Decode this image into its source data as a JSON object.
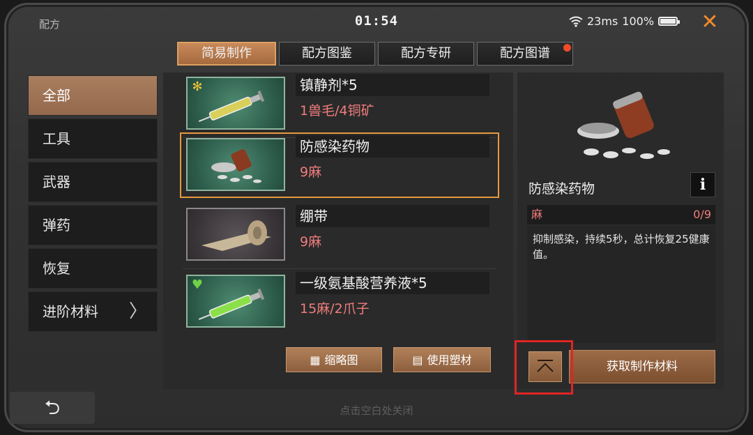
{
  "header": {
    "app_title": "配方",
    "clock": "01:54",
    "ping": "23ms",
    "battery": "100%",
    "close_icon": "close-icon"
  },
  "tabs": [
    {
      "label": "简易制作",
      "active": true
    },
    {
      "label": "配方图鉴",
      "active": false
    },
    {
      "label": "配方专研",
      "active": false
    },
    {
      "label": "配方图谱",
      "active": false,
      "has_badge": true
    }
  ],
  "sidebar": {
    "items": [
      {
        "label": "全部",
        "active": true
      },
      {
        "label": "工具"
      },
      {
        "label": "武器"
      },
      {
        "label": "弹药"
      },
      {
        "label": "恢复"
      },
      {
        "label": "进阶材料",
        "has_arrow": true
      }
    ]
  },
  "recipes": [
    {
      "name": "镇静剂*5",
      "cost": "1兽毛/4铜矿",
      "icon": "syringe-yellow",
      "badge_icon": "snowflake-icon"
    },
    {
      "name": "防感染药物",
      "cost": "9麻",
      "icon": "pill-bottle",
      "selected": true
    },
    {
      "name": "绷带",
      "cost": "9麻",
      "icon": "bandage-roll"
    },
    {
      "name": "一级氨基酸营养液*5",
      "cost": "15麻/2爪子",
      "icon": "syringe-green",
      "badge_icon": "heart-plus-icon"
    }
  ],
  "list_buttons": {
    "thumbnail": "缩略图",
    "use_plastic": "使用塑材"
  },
  "detail": {
    "name": "防感染药物",
    "info_label": "i",
    "requirement_name": "麻",
    "requirement_count": "0/9",
    "description": "抑制感染，持续5秒，总计恢复25健康值。",
    "get_materials": "获取制作材料"
  },
  "footer": {
    "hint": "点击空白处关闭",
    "back_icon": "back-arrow-icon"
  },
  "colors": {
    "accent": "#e79a3e",
    "tab_active": "#b27a4e",
    "cost_text": "#f07d7d",
    "highlight": "#e22424"
  }
}
